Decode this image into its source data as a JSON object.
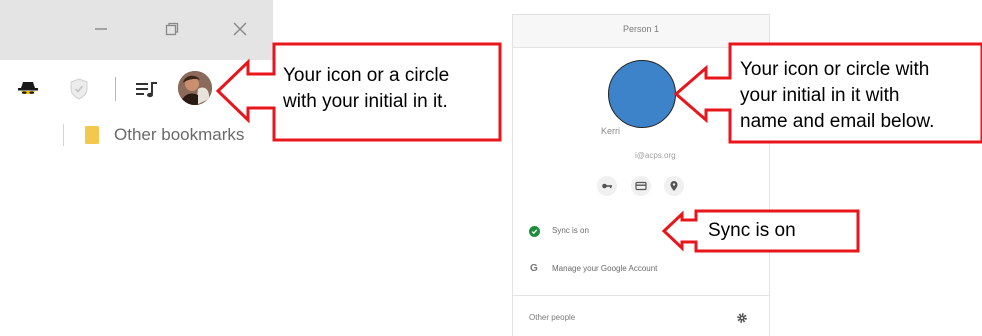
{
  "browser": {
    "window_controls": {
      "minimize_icon": "minimize-icon",
      "restore_icon": "restore-icon",
      "close_icon": "close-icon"
    },
    "toolbar_icons": [
      "incognito-spy-icon",
      "shield-icon",
      "media-queue-icon",
      "profile-avatar-icon"
    ],
    "bookmarks": {
      "folder_icon": "folder-icon",
      "label": "Other bookmarks"
    }
  },
  "callouts": {
    "left": {
      "line1": "Your icon or a circle",
      "line2": "with your initial in it."
    },
    "top_right": {
      "line1": "Your icon or circle with",
      "line2": "your initial in it with",
      "line3": "name and email below."
    },
    "sync": {
      "text": "Sync is on"
    }
  },
  "profile_popup": {
    "title": "Person 1",
    "name": "Kerri",
    "email": "i@acps.org",
    "quick_actions": [
      "key-icon",
      "credit-card-icon",
      "location-pin-icon"
    ],
    "sync_label": "Sync is on",
    "manage_label": "Manage your Google Account",
    "other_people_label": "Other people",
    "gear_icon": "gear-icon"
  },
  "colors": {
    "callout_red": "#e8151b",
    "avatar_blue": "#3d83c9",
    "sync_green": "#1e8e3e",
    "titlebar_gray": "#e4e4e4"
  }
}
